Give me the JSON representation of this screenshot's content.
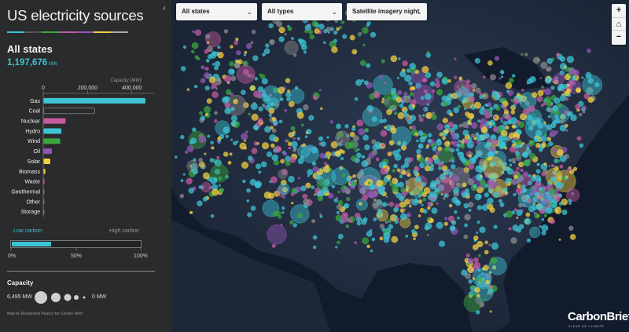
{
  "sidebar": {
    "title": "US electricity sources",
    "rule_colors": [
      "#3cc4d4",
      "#555555",
      "#3aa640",
      "#c45aa0",
      "#9257b6",
      "#f1cf41",
      "#aaaaaa"
    ],
    "region_name": "All states",
    "region_total": "1,197,676",
    "region_unit": "MW",
    "low_carbon_label": "Low carbon",
    "high_carbon_label": "High carbon",
    "low_carbon_share": 0.3,
    "pct_ticks": [
      "0%",
      "50%",
      "100%"
    ],
    "capacity_title": "Capacity",
    "capacity_max": "6,495 MW",
    "capacity_min": "0 MW",
    "credit": "Map by Rosamund Pearce for Carbon Brief",
    "collapse_icon": "‹"
  },
  "controls": {
    "states_value": "All states",
    "types_value": "All types",
    "basemap_value": "Satellite imagery night",
    "chevron": "⌄",
    "zoom_in": "+",
    "zoom_home": "⌂",
    "zoom_out": "−"
  },
  "logo": {
    "name": "CarbonBrief",
    "tagline": "CLEAR ON CLIMATE"
  },
  "chart_data": {
    "type": "bar",
    "orientation": "horizontal",
    "xlabel": "Capacity (MW)",
    "xlim": [
      0,
      500000
    ],
    "ticks": [
      0,
      200000,
      400000
    ],
    "tick_labels": [
      "0",
      "200,000",
      "400,000"
    ],
    "categories": [
      "Gas",
      "Coal",
      "Nuclear",
      "Hydro",
      "Wind",
      "Oil",
      "Solar",
      "Biomass",
      "Waste",
      "Geothermal",
      "Other",
      "Storage"
    ],
    "values": [
      459000,
      230000,
      99000,
      80000,
      75000,
      37000,
      30000,
      7500,
      4000,
      3500,
      2500,
      1200
    ],
    "colors": [
      "#3cc4d4",
      "#555555",
      "#c45aa0",
      "#3cc4d4",
      "#3aa640",
      "#9257b6",
      "#f1cf41",
      "#f1cf41",
      "#c45aa0",
      "#c45aa0",
      "#888888",
      "#888888"
    ],
    "outlined": [
      false,
      true,
      false,
      false,
      false,
      false,
      false,
      false,
      false,
      false,
      false,
      false
    ]
  }
}
